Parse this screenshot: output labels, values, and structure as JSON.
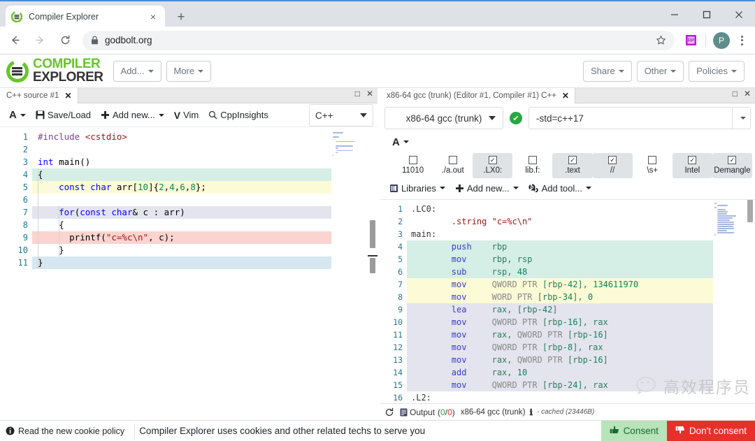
{
  "browser": {
    "tab": {
      "title": "Compiler Explorer",
      "favicon": "compiler-explorer-icon",
      "close": "×"
    },
    "newtab_label": "+",
    "window_controls": {
      "minimize": "minimize-icon",
      "maximize": "maximize-icon",
      "close": "close-icon"
    },
    "nav": {
      "back": "back-arrow-icon",
      "forward": "forward-arrow-icon",
      "reload": "reload-icon"
    },
    "omnibox": {
      "url": "godbolt.org",
      "lock": "lock-icon",
      "star": "star-icon"
    },
    "extension_icon": "extension-icon",
    "profile_initial": "P",
    "menu": "kebab-menu-icon"
  },
  "ce_nav": {
    "logo_line1": "COMPILER",
    "logo_line2": "EXPLORER",
    "buttons": [
      {
        "label": "Add...",
        "caret": true
      },
      {
        "label": "More",
        "caret": true
      }
    ],
    "right_buttons": [
      {
        "label": "Share",
        "caret": true
      },
      {
        "label": "Other",
        "caret": true
      },
      {
        "label": "Policies",
        "caret": true
      }
    ]
  },
  "editor_pane": {
    "tab_title": "C++ source #1",
    "tab_close": "✕",
    "header_controls": {
      "maximize": "□",
      "close": "✕"
    },
    "tools": [
      {
        "name": "font-size",
        "label": "A",
        "caret": true
      },
      {
        "name": "save-load",
        "label": "Save/Load",
        "icon": "floppy-icon"
      },
      {
        "name": "add-new",
        "label": "Add new...",
        "icon": "plus-icon",
        "caret": true
      },
      {
        "name": "vim",
        "label": "Vim",
        "icon": "vim-icon"
      },
      {
        "name": "cppinsights",
        "label": "CppInsights",
        "icon": "magnifier-icon"
      }
    ],
    "language": "C++",
    "code_lines": [
      {
        "n": 1,
        "hl": null,
        "tokens": [
          {
            "t": "#include ",
            "c": "k-purple"
          },
          {
            "t": "<cstdio>",
            "c": "k-red"
          }
        ]
      },
      {
        "n": 2,
        "hl": null,
        "tokens": []
      },
      {
        "n": 3,
        "hl": null,
        "tokens": [
          {
            "t": "int ",
            "c": "k-blue"
          },
          {
            "t": "main()",
            "c": "k-txt"
          }
        ]
      },
      {
        "n": 4,
        "hl": "#d5eee6",
        "tokens": [
          {
            "t": "{",
            "c": "k-txt"
          }
        ]
      },
      {
        "n": 5,
        "hl": "#fbfbd6",
        "tokens": [
          {
            "t": "    ",
            "c": "k-txt"
          },
          {
            "t": "const char ",
            "c": "k-blue"
          },
          {
            "t": "arr[",
            "c": "k-txt"
          },
          {
            "t": "10",
            "c": "k-green"
          },
          {
            "t": "]{",
            "c": "k-txt"
          },
          {
            "t": "2",
            "c": "k-green"
          },
          {
            "t": ",",
            "c": "k-txt"
          },
          {
            "t": "4",
            "c": "k-green"
          },
          {
            "t": ",",
            "c": "k-txt"
          },
          {
            "t": "6",
            "c": "k-green"
          },
          {
            "t": ",",
            "c": "k-txt"
          },
          {
            "t": "8",
            "c": "k-green"
          },
          {
            "t": "};",
            "c": "k-txt"
          }
        ]
      },
      {
        "n": 6,
        "hl": null,
        "tokens": []
      },
      {
        "n": 7,
        "hl": "#e4e4ef",
        "tokens": [
          {
            "t": "    ",
            "c": "k-txt"
          },
          {
            "t": "for",
            "c": "k-blue"
          },
          {
            "t": "(",
            "c": "k-txt"
          },
          {
            "t": "const char",
            "c": "k-blue"
          },
          {
            "t": "& c : arr)",
            "c": "k-txt"
          }
        ]
      },
      {
        "n": 8,
        "hl": null,
        "tokens": [
          {
            "t": "    {",
            "c": "k-txt"
          }
        ]
      },
      {
        "n": 9,
        "hl": "#fbd4d0",
        "tokens": [
          {
            "t": "      printf(",
            "c": "k-txt"
          },
          {
            "t": "\"c=%c\\n\"",
            "c": "k-red"
          },
          {
            "t": ", c);",
            "c": "k-txt"
          }
        ]
      },
      {
        "n": 10,
        "hl": null,
        "tokens": [
          {
            "t": "    }",
            "c": "k-txt"
          }
        ]
      },
      {
        "n": 11,
        "hl": "#d6e7f2",
        "tokens": [
          {
            "t": "}",
            "c": "k-txt"
          }
        ]
      }
    ]
  },
  "compiler_pane": {
    "tab_title": "x86-64 gcc (trunk) (Editor #1, Compiler #1) C++",
    "tab_close": "✕",
    "header_controls": {
      "maximize": "□",
      "close": "✕"
    },
    "compiler_name": "x86-64 gcc (trunk)",
    "status_ok": "✔",
    "options": "-std=c++17",
    "font_button": "A",
    "filters": [
      {
        "name": "binary",
        "label": "11010",
        "checked": false,
        "active": false
      },
      {
        "name": "execute",
        "label": "./a.out",
        "checked": false,
        "active": false
      },
      {
        "name": "labels",
        "label": ".LX0:",
        "checked": true,
        "active": true
      },
      {
        "name": "library-functions",
        "label": "lib.f:",
        "checked": false,
        "active": false
      },
      {
        "name": "directives",
        "label": ".text",
        "checked": true,
        "active": true
      },
      {
        "name": "comments",
        "label": "//",
        "checked": true,
        "active": true
      },
      {
        "name": "trim-whitespace",
        "label": "\\s+",
        "checked": false,
        "active": false
      },
      {
        "name": "intel-syntax",
        "label": "Intel",
        "checked": true,
        "active": true
      },
      {
        "name": "demangle",
        "label": "Demangle",
        "checked": true,
        "active": true
      }
    ],
    "lib_row": [
      {
        "name": "libraries",
        "label": "Libraries",
        "icon": "books-icon",
        "caret": true
      },
      {
        "name": "add-new",
        "label": "Add new...",
        "icon": "plus-icon",
        "caret": true
      },
      {
        "name": "add-tool",
        "label": "Add tool...",
        "icon": "gears-icon",
        "caret": true
      }
    ],
    "asm_lines": [
      {
        "n": 1,
        "hl": null,
        "tokens": [
          {
            "t": ".LC0:",
            "c": "a-lbl"
          }
        ]
      },
      {
        "n": 2,
        "hl": null,
        "tokens": [
          {
            "t": "        .string ",
            "c": "a-dir"
          },
          {
            "t": "\"c=%c\\n\"",
            "c": "a-str"
          }
        ]
      },
      {
        "n": 3,
        "hl": null,
        "tokens": [
          {
            "t": "main:",
            "c": "a-lbl"
          }
        ]
      },
      {
        "n": 4,
        "hl": "#d5eee6",
        "tokens": [
          {
            "t": "        push    ",
            "c": "a-op"
          },
          {
            "t": "rbp",
            "c": "a-reg"
          }
        ]
      },
      {
        "n": 5,
        "hl": "#d5eee6",
        "tokens": [
          {
            "t": "        mov     ",
            "c": "a-op"
          },
          {
            "t": "rbp, rsp",
            "c": "a-reg"
          }
        ]
      },
      {
        "n": 6,
        "hl": "#d5eee6",
        "tokens": [
          {
            "t": "        sub     ",
            "c": "a-op"
          },
          {
            "t": "rsp, ",
            "c": "a-reg"
          },
          {
            "t": "48",
            "c": "a-num"
          }
        ]
      },
      {
        "n": 7,
        "hl": "#fbfbd6",
        "tokens": [
          {
            "t": "        mov     ",
            "c": "a-op"
          },
          {
            "t": "QWORD PTR ",
            "c": "a-ptr"
          },
          {
            "t": "[rbp-",
            "c": "a-reg"
          },
          {
            "t": "42",
            "c": "a-num"
          },
          {
            "t": "], ",
            "c": "a-reg"
          },
          {
            "t": "134611970",
            "c": "a-num"
          }
        ]
      },
      {
        "n": 8,
        "hl": "#fbfbd6",
        "tokens": [
          {
            "t": "        mov     ",
            "c": "a-op"
          },
          {
            "t": "WORD PTR ",
            "c": "a-ptr"
          },
          {
            "t": "[rbp-",
            "c": "a-reg"
          },
          {
            "t": "34",
            "c": "a-num"
          },
          {
            "t": "], ",
            "c": "a-reg"
          },
          {
            "t": "0",
            "c": "a-num"
          }
        ]
      },
      {
        "n": 9,
        "hl": "#e4e4ef",
        "tokens": [
          {
            "t": "        lea     ",
            "c": "a-op"
          },
          {
            "t": "rax, [rbp-",
            "c": "a-reg"
          },
          {
            "t": "42",
            "c": "a-num"
          },
          {
            "t": "]",
            "c": "a-reg"
          }
        ]
      },
      {
        "n": 10,
        "hl": "#e4e4ef",
        "tokens": [
          {
            "t": "        mov     ",
            "c": "a-op"
          },
          {
            "t": "QWORD PTR ",
            "c": "a-ptr"
          },
          {
            "t": "[rbp-",
            "c": "a-reg"
          },
          {
            "t": "16",
            "c": "a-num"
          },
          {
            "t": "], rax",
            "c": "a-reg"
          }
        ]
      },
      {
        "n": 11,
        "hl": "#e4e4ef",
        "tokens": [
          {
            "t": "        mov     ",
            "c": "a-op"
          },
          {
            "t": "rax, ",
            "c": "a-reg"
          },
          {
            "t": "QWORD PTR ",
            "c": "a-ptr"
          },
          {
            "t": "[rbp-",
            "c": "a-reg"
          },
          {
            "t": "16",
            "c": "a-num"
          },
          {
            "t": "]",
            "c": "a-reg"
          }
        ]
      },
      {
        "n": 12,
        "hl": "#e4e4ef",
        "tokens": [
          {
            "t": "        mov     ",
            "c": "a-op"
          },
          {
            "t": "QWORD PTR ",
            "c": "a-ptr"
          },
          {
            "t": "[rbp-",
            "c": "a-reg"
          },
          {
            "t": "8",
            "c": "a-num"
          },
          {
            "t": "], rax",
            "c": "a-reg"
          }
        ]
      },
      {
        "n": 13,
        "hl": "#e4e4ef",
        "tokens": [
          {
            "t": "        mov     ",
            "c": "a-op"
          },
          {
            "t": "rax, ",
            "c": "a-reg"
          },
          {
            "t": "QWORD PTR ",
            "c": "a-ptr"
          },
          {
            "t": "[rbp-",
            "c": "a-reg"
          },
          {
            "t": "16",
            "c": "a-num"
          },
          {
            "t": "]",
            "c": "a-reg"
          }
        ]
      },
      {
        "n": 14,
        "hl": "#e4e4ef",
        "tokens": [
          {
            "t": "        add     ",
            "c": "a-op"
          },
          {
            "t": "rax, ",
            "c": "a-reg"
          },
          {
            "t": "10",
            "c": "a-num"
          }
        ]
      },
      {
        "n": 15,
        "hl": "#e4e4ef",
        "tokens": [
          {
            "t": "        mov     ",
            "c": "a-op"
          },
          {
            "t": "QWORD PTR ",
            "c": "a-ptr"
          },
          {
            "t": "[rbp-",
            "c": "a-reg"
          },
          {
            "t": "24",
            "c": "a-num"
          },
          {
            "t": "], rax",
            "c": "a-reg"
          }
        ]
      },
      {
        "n": 16,
        "hl": null,
        "tokens": [
          {
            "t": ".L2:",
            "c": "a-lbl"
          }
        ]
      }
    ],
    "status": {
      "reload_icon": "reload-icon",
      "output_icon": "output-icon",
      "output_label": "Output",
      "output_counts_open": "(",
      "output_ok": "0",
      "output_slash": "/",
      "output_err": "0",
      "output_counts_close": ")",
      "compiler": "x86-64 gcc (trunk)",
      "info_icon": "info-icon",
      "cached": "- cached (23446B)"
    }
  },
  "watermark": {
    "text": "高效程序员",
    "icon": "wechat-icon"
  },
  "cookie_bar": {
    "link": "Read the new cookie policy",
    "link_icon": "info-icon",
    "message": "Compiler Explorer uses cookies and other related techs to serve you",
    "consent": "Consent",
    "consent_icon": "thumbs-up-icon",
    "deny": "Don't consent",
    "deny_icon": "thumbs-down-icon"
  },
  "colors": {
    "accent_green": "#67c52a",
    "ok_green": "#28a745",
    "deny_red": "#e8302a",
    "consent_bg": "#b9e3ba",
    "line_hl_green": "#d5eee6",
    "line_hl_yellow": "#fbfbd6",
    "line_hl_purple": "#e4e4ef",
    "line_hl_red": "#fbd4d0",
    "line_hl_blue": "#d6e7f2"
  }
}
